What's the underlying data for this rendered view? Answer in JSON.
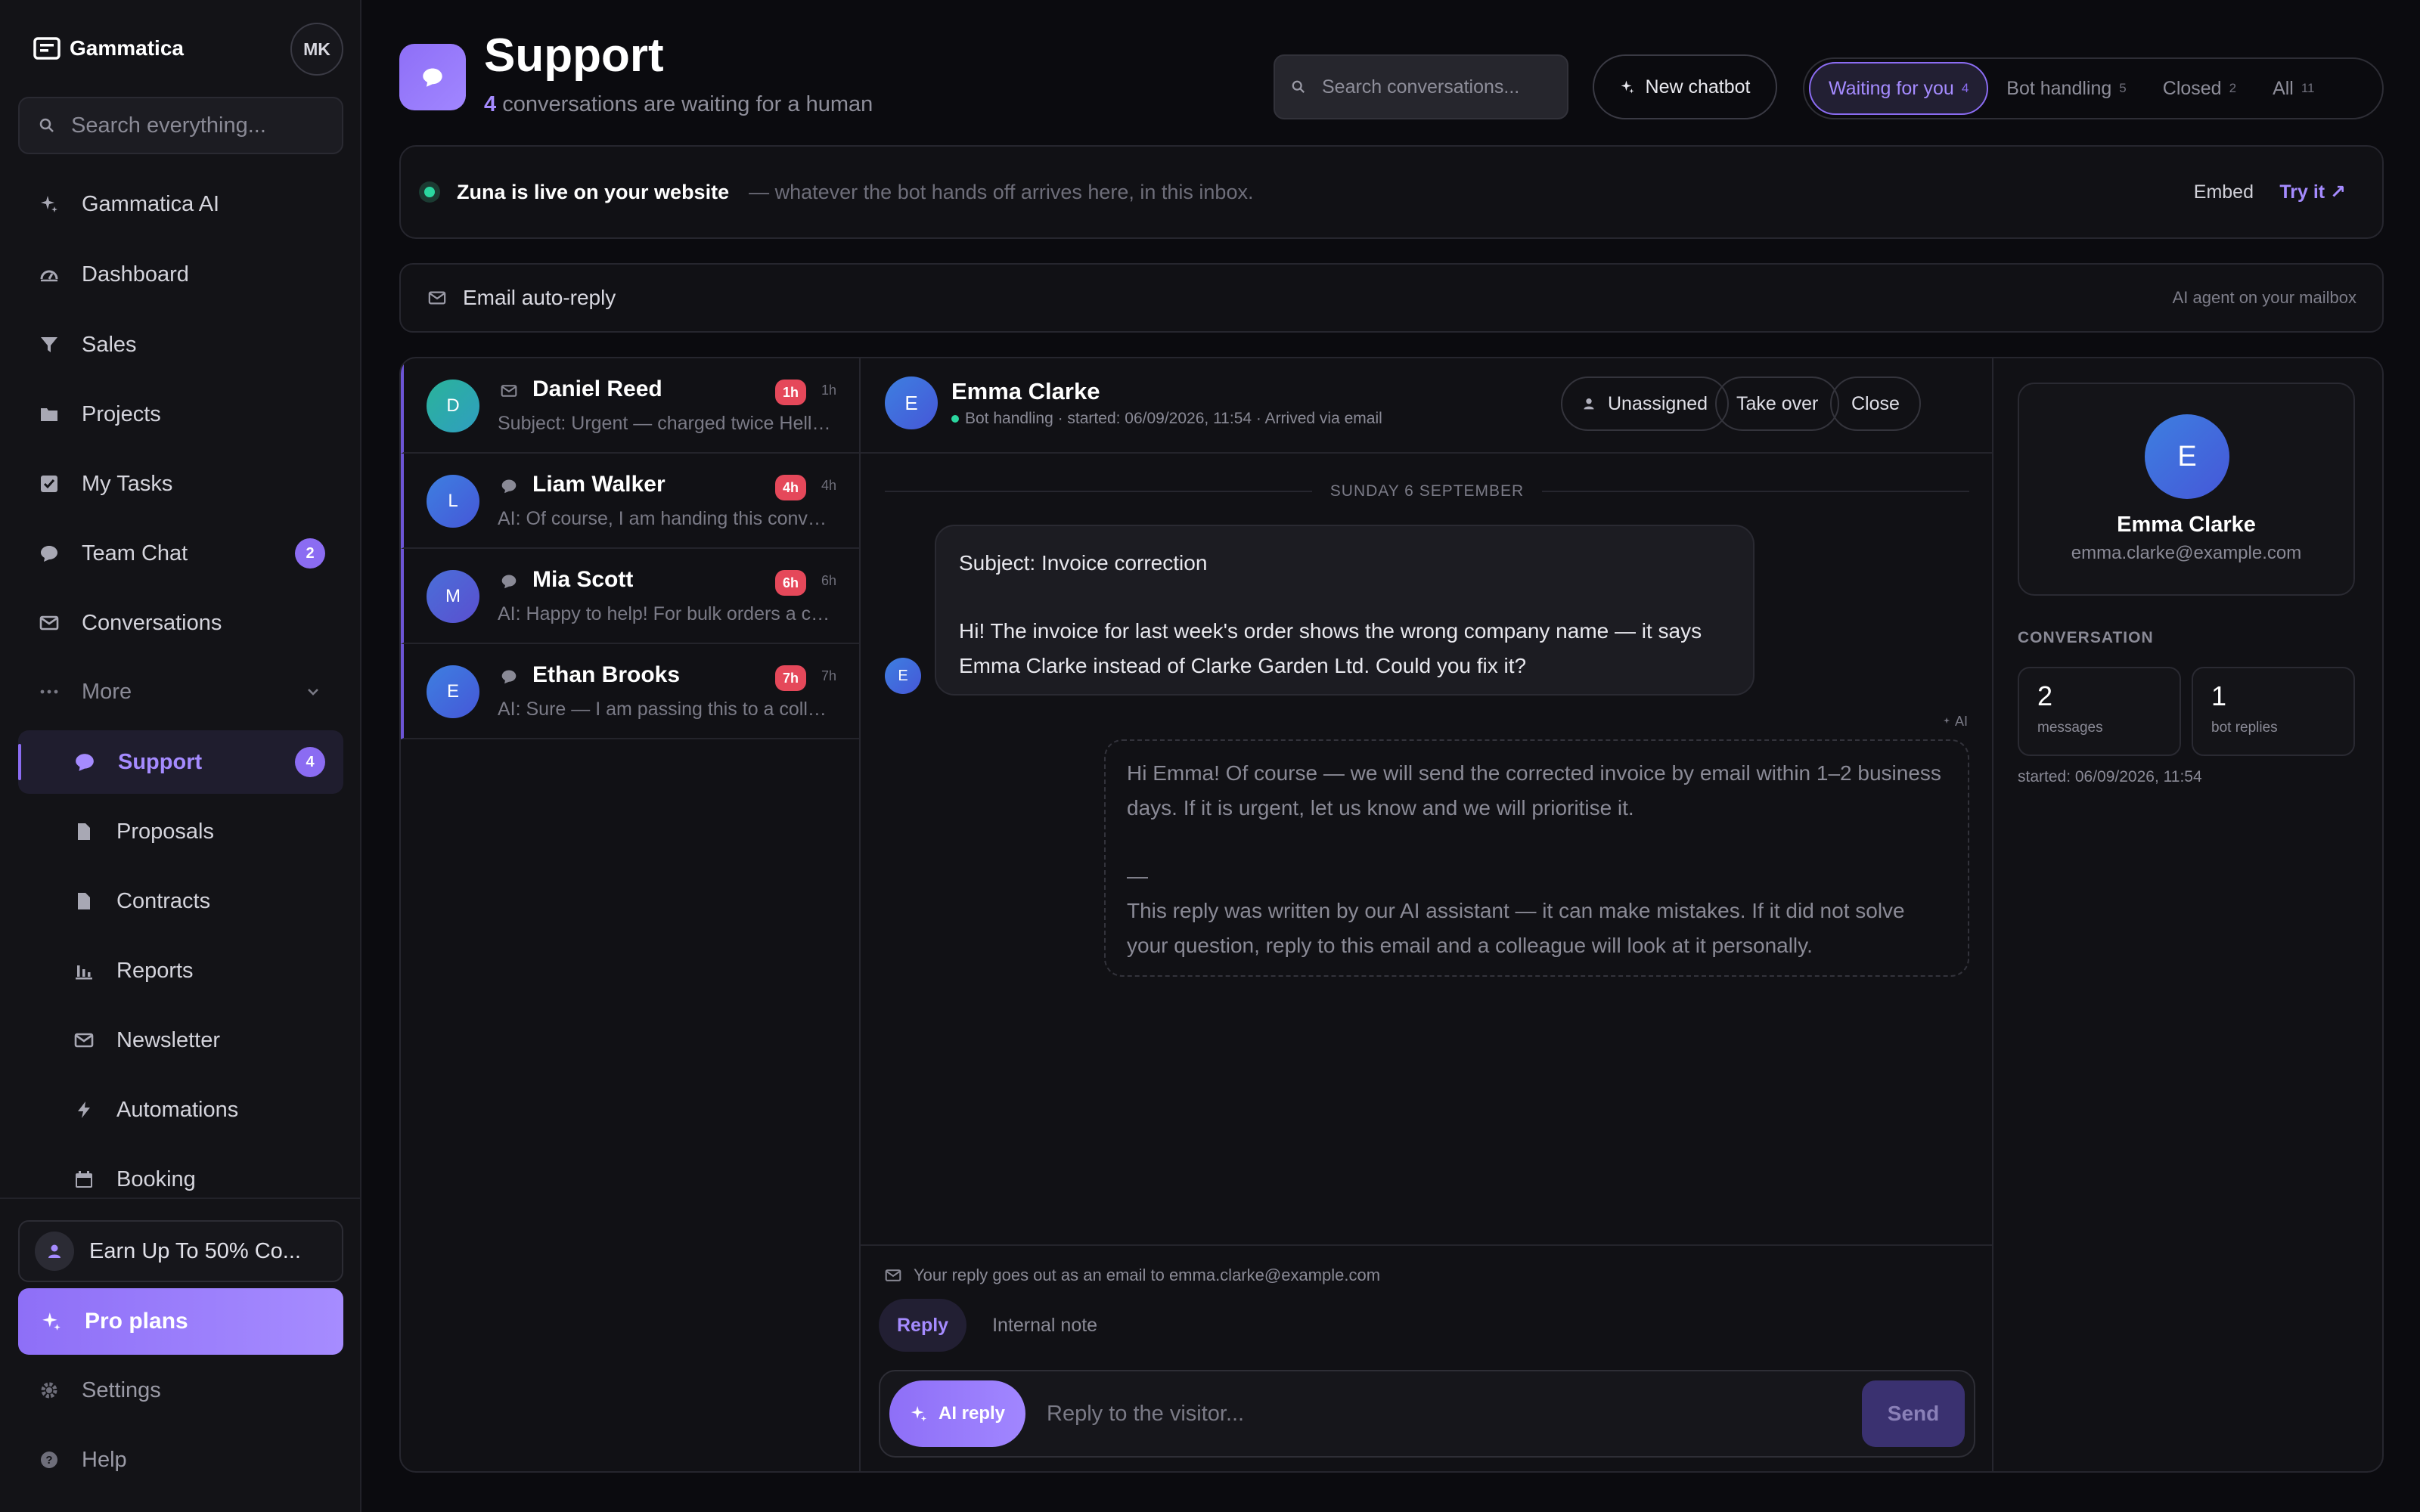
{
  "sidebar": {
    "brand": "Gammatica",
    "user_initials": "MK",
    "search_placeholder": "Search everything...",
    "items": [
      {
        "label": "Gammatica AI",
        "icon": "sparkle-icon"
      },
      {
        "label": "Dashboard",
        "icon": "gauge-icon"
      },
      {
        "label": "Sales",
        "icon": "funnel-icon"
      },
      {
        "label": "Projects",
        "icon": "folder-icon"
      },
      {
        "label": "My Tasks",
        "icon": "checkbox-icon"
      },
      {
        "label": "Team Chat",
        "icon": "chat-bubble-icon",
        "badge": "2"
      },
      {
        "label": "Conversations",
        "icon": "mail-icon"
      },
      {
        "label": "More",
        "icon": "dots-icon"
      }
    ],
    "sub_items": [
      {
        "label": "Support",
        "icon": "chat-bubble-icon",
        "badge": "4",
        "active": true
      },
      {
        "label": "Proposals",
        "icon": "document-icon"
      },
      {
        "label": "Contracts",
        "icon": "document-icon"
      },
      {
        "label": "Reports",
        "icon": "bar-chart-icon"
      },
      {
        "label": "Newsletter",
        "icon": "mail-icon"
      },
      {
        "label": "Automations",
        "icon": "lightning-icon"
      },
      {
        "label": "Booking",
        "icon": "calendar-icon"
      }
    ],
    "earn_label": "Earn Up To 50% Co...",
    "pro_label": "Pro plans",
    "settings_label": "Settings",
    "help_label": "Help"
  },
  "header": {
    "title": "Support",
    "waiting_count": "4",
    "subtitle_rest": " conversations are waiting for a human",
    "search_placeholder": "Search conversations...",
    "new_chatbot_label": "New chatbot",
    "tabs": [
      {
        "label": "Waiting for you",
        "count": "4",
        "active": true
      },
      {
        "label": "Bot handling",
        "count": "5"
      },
      {
        "label": "Closed",
        "count": "2"
      },
      {
        "label": "All",
        "count": "11"
      }
    ]
  },
  "live_banner": {
    "title": "Zuna is live on your website",
    "text": "— whatever the bot hands off arrives here, in this inbox.",
    "embed_label": "Embed",
    "try_label": "Try it ↗"
  },
  "autoreply": {
    "label": "Email auto-reply",
    "right_text": "AI agent on your mailbox"
  },
  "conversations": [
    {
      "initial": "D",
      "name": "Daniel Reed",
      "channel": "mail",
      "preview": "Subject: Urgent — charged twice Hello, I was charged twice",
      "badge": "1h",
      "age": "1h",
      "color": "#2ab39a"
    },
    {
      "initial": "L",
      "name": "Liam Walker",
      "channel": "chat",
      "preview": "AI: Of course, I am handing this conversation to a colleague",
      "badge": "4h",
      "age": "4h",
      "color": "#3f6fd8"
    },
    {
      "initial": "M",
      "name": "Mia Scott",
      "channel": "chat",
      "preview": "AI: Happy to help! For bulk orders a colleague will follow up",
      "badge": "6h",
      "age": "6h",
      "color": "#4b63d6"
    },
    {
      "initial": "E",
      "name": "Ethan Brooks",
      "channel": "chat",
      "preview": "AI: Sure — I am passing this to a colleague right away",
      "badge": "7h",
      "age": "7h",
      "color": "#3f6fd8"
    }
  ],
  "thread": {
    "initial": "E",
    "name": "Emma Clarke",
    "meta": "Bot handling · started: 06/09/2026, 11:54 · Arrived via email",
    "unassigned_label": "Unassigned",
    "take_over_label": "Take over",
    "close_label": "Close",
    "day_separator": "SUNDAY 6 SEPTEMBER",
    "incoming_subject": "Subject: Invoice correction",
    "incoming_body": "Hi! The invoice for last week's order shows the wrong company name — it says Emma Clarke instead of Clarke Garden Ltd. Could you fix it?",
    "ai_tag": "AI",
    "outgoing_body": "Hi Emma! Of course — we will send the corrected invoice by email within 1–2 business days. If it is urgent, let us know and we will prioritise it.",
    "outgoing_dash": "—",
    "outgoing_disclaimer": "This reply was written by our AI assistant — it can make mistakes. If it did not solve your question, reply to this email and a colleague will look at it personally."
  },
  "compose": {
    "note": "Your reply goes out as an email to emma.clarke@example.com",
    "reply_tab": "Reply",
    "internal_note_tab": "Internal note",
    "ai_reply_label": "AI reply",
    "placeholder": "Reply to the visitor...",
    "send_label": "Send"
  },
  "contact": {
    "initial": "E",
    "name": "Emma Clarke",
    "email": "emma.clarke@example.com",
    "section_label": "CONVERSATION",
    "messages_value": "2",
    "messages_label": "messages",
    "bot_replies_value": "1",
    "bot_replies_label": "bot replies",
    "started": "started: 06/09/2026, 11:54"
  },
  "colors": {
    "accent": "#8b6cf2",
    "accent_text": "#a58bff",
    "danger": "#e5485a",
    "online": "#2bd69f",
    "background": "#0b0b0f"
  }
}
